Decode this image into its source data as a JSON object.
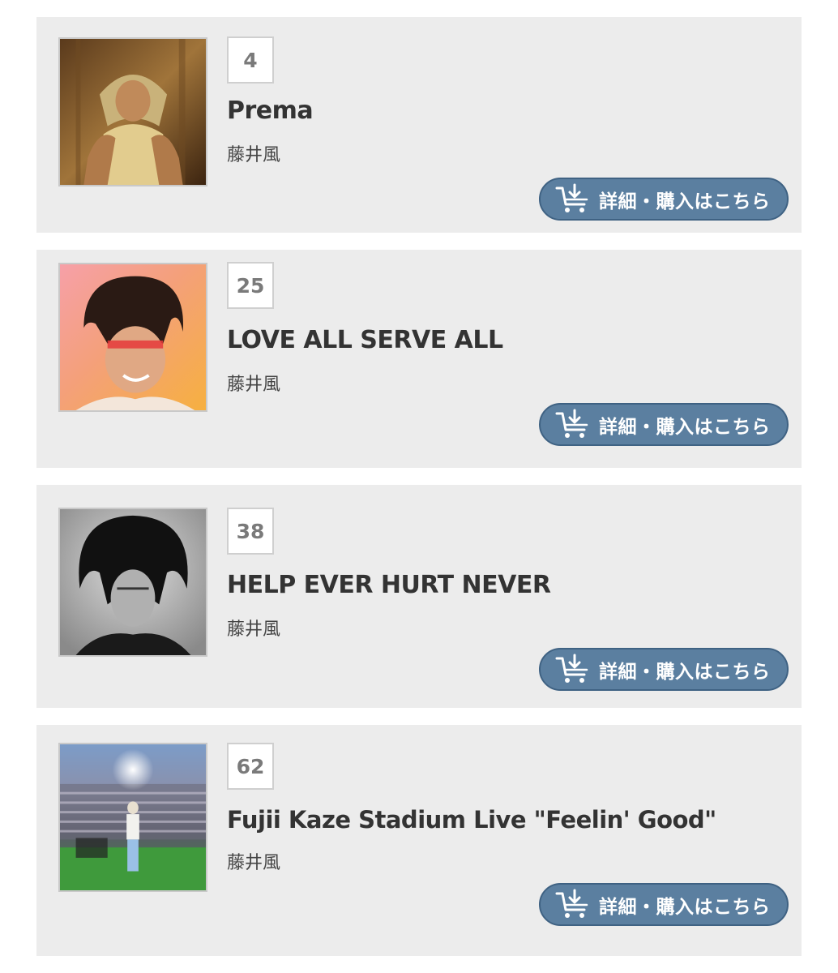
{
  "items": [
    {
      "rank": "4",
      "title": "Prema",
      "artist": "藤井風",
      "button_label": "詳細・購入はこちら",
      "cover": "cover-prema"
    },
    {
      "rank": "25",
      "title": "LOVE ALL SERVE ALL",
      "artist": "藤井風",
      "button_label": "詳細・購入はこちら",
      "cover": "cover-love-all-serve-all"
    },
    {
      "rank": "38",
      "title": "HELP EVER HURT NEVER",
      "artist": "藤井風",
      "button_label": "詳細・購入はこちら",
      "cover": "cover-help-ever-hurt-never"
    },
    {
      "rank": "62",
      "title": "Fujii Kaze Stadium Live \"Feelin' Good\"",
      "artist": "藤井風",
      "button_label": "詳細・購入はこちら",
      "cover": "cover-stadium-live"
    }
  ],
  "icons": {
    "buy": "cart-download-icon"
  },
  "colors": {
    "card_bg": "#ececec",
    "button_bg": "#5b7fa0",
    "rank_text": "#7a7a7a"
  }
}
